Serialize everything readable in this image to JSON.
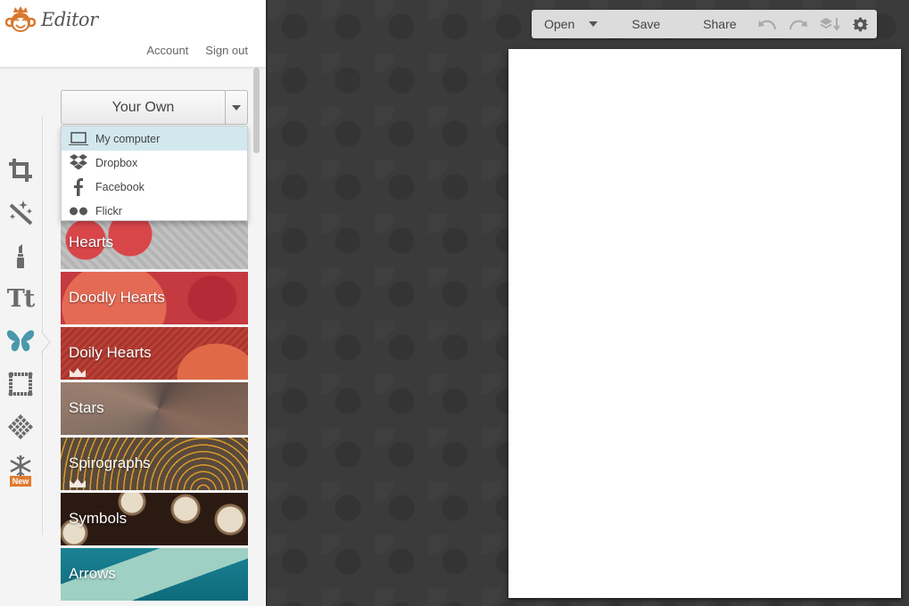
{
  "header": {
    "app_title": "Editor",
    "links": [
      "Account",
      "Sign out"
    ]
  },
  "tool_rail": {
    "tools": [
      {
        "name": "crop",
        "icon": "crop-icon"
      },
      {
        "name": "effects",
        "icon": "magic-wand-icon"
      },
      {
        "name": "touch-up",
        "icon": "lipstick-icon"
      },
      {
        "name": "text",
        "icon": "text-icon",
        "glyph": "Tt"
      },
      {
        "name": "overlays",
        "icon": "butterfly-icon",
        "active": true
      },
      {
        "name": "frames",
        "icon": "frame-icon"
      },
      {
        "name": "textures",
        "icon": "texture-icon"
      },
      {
        "name": "seasonal",
        "icon": "snowflake-icon",
        "badge": "New"
      }
    ],
    "active_color": "#4a98ab",
    "badge_color": "#e07a2e"
  },
  "source_select": {
    "selected": "Your Own",
    "options": [
      {
        "label": "My computer",
        "icon": "laptop-icon",
        "highlighted": true
      },
      {
        "label": "Dropbox",
        "icon": "dropbox-icon"
      },
      {
        "label": "Facebook",
        "icon": "facebook-icon"
      },
      {
        "label": "Flickr",
        "icon": "flickr-icon"
      }
    ]
  },
  "categories": [
    {
      "label": "Hearts",
      "premium": false
    },
    {
      "label": "Doodly Hearts",
      "premium": false
    },
    {
      "label": "Doily Hearts",
      "premium": true
    },
    {
      "label": "Stars",
      "premium": false
    },
    {
      "label": "Spirographs",
      "premium": true
    },
    {
      "label": "Symbols",
      "premium": false
    },
    {
      "label": "Arrows",
      "premium": false
    }
  ],
  "toolbar": {
    "open_label": "Open",
    "save_label": "Save",
    "share_label": "Share"
  }
}
